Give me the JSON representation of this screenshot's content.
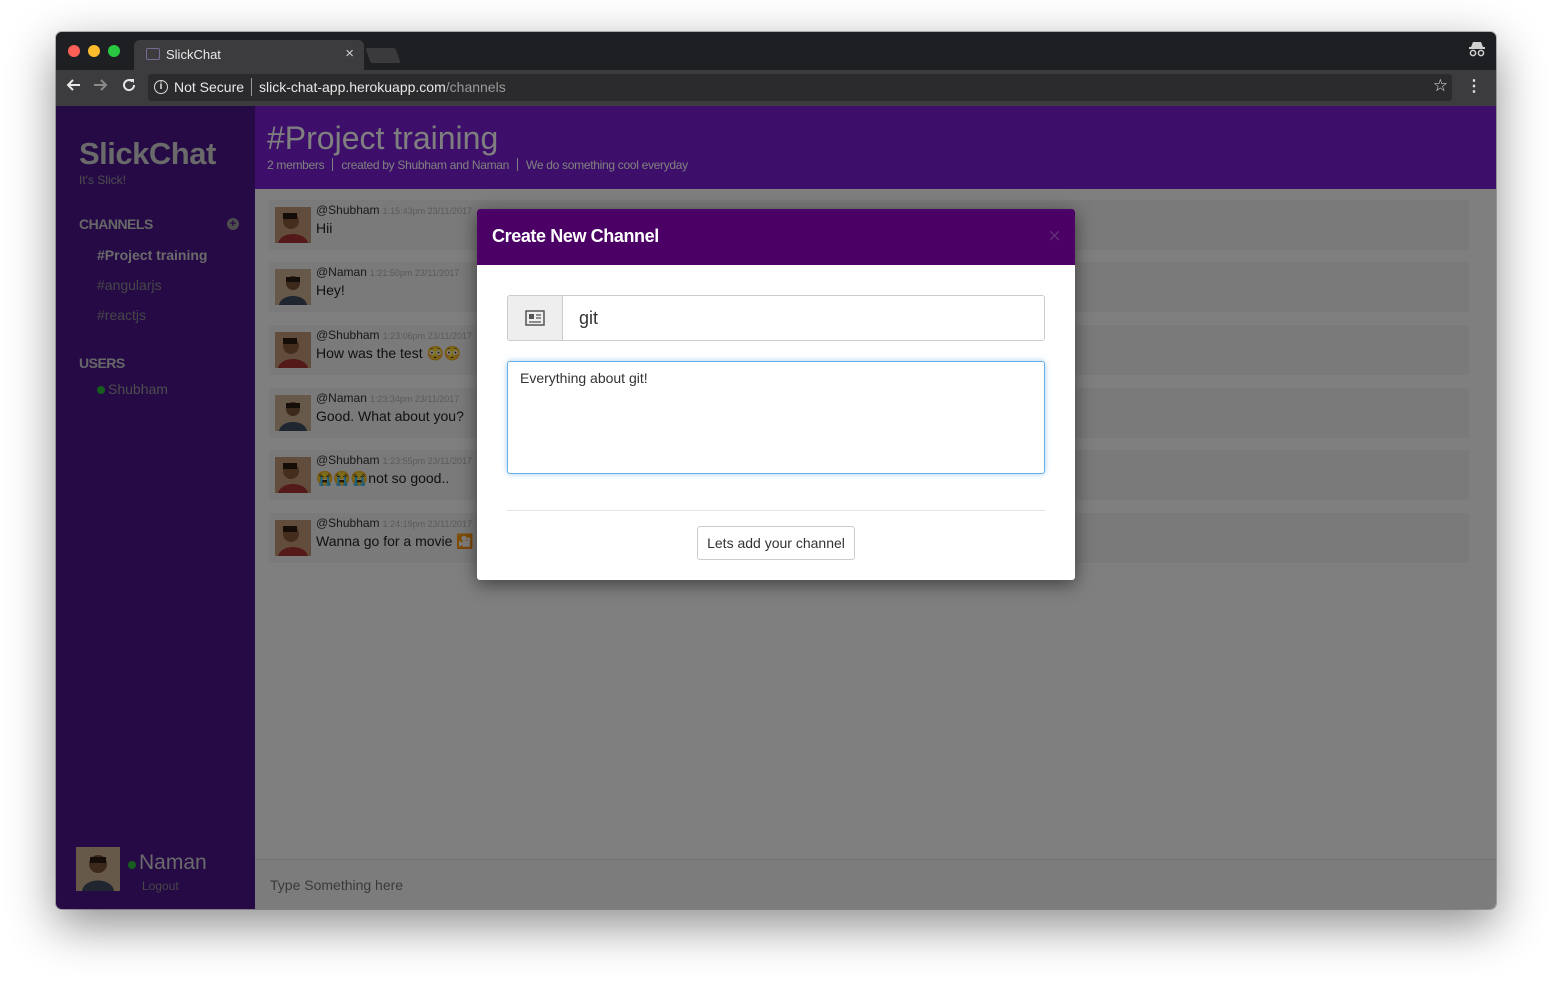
{
  "browser": {
    "tab_title": "SlickChat",
    "tab_close": "×",
    "security_label": "Not Secure",
    "url_host": "slick-chat-app.herokuapp.com",
    "url_path": "/channels"
  },
  "sidebar": {
    "brand": "SlickChat",
    "tagline": "It's Slick!",
    "channels_heading": "CHANNELS",
    "channels": [
      {
        "label": "#Project training",
        "active": true
      },
      {
        "label": "#angularjs",
        "active": false
      },
      {
        "label": "#reactjs",
        "active": false
      }
    ],
    "users_heading": "USERS",
    "users": [
      {
        "label": "Shubham",
        "status_color": "#2dbd3a"
      }
    ],
    "current_user": {
      "name": "Naman",
      "logout": "Logout",
      "status_color": "#2dbd3a"
    }
  },
  "channel": {
    "title": "#Project training",
    "members": "2 members",
    "created_by": "created by Shubham and Naman",
    "description": "We do something cool everyday"
  },
  "messages": [
    {
      "author": "@Shubham",
      "time": "1:15:43pm 23/11/2017",
      "text": "Hii"
    },
    {
      "author": "@Naman",
      "time": "1:21:50pm 23/11/2017",
      "text": "Hey!"
    },
    {
      "author": "@Shubham",
      "time": "1:23:06pm 23/11/2017",
      "text": "How was the test 😳😳"
    },
    {
      "author": "@Naman",
      "time": "1:23:34pm 23/11/2017",
      "text": "Good. What about you?"
    },
    {
      "author": "@Shubham",
      "time": "1:23:55pm 23/11/2017",
      "text": "😭😭😭not so good.."
    },
    {
      "author": "@Shubham",
      "time": "1:24:19pm 23/11/2017",
      "text": "Wanna go for a movie 🎦"
    }
  ],
  "composer": {
    "placeholder": "Type Something here"
  },
  "modal": {
    "title": "Create New Channel",
    "close": "×",
    "name_value": "git",
    "description_value": "Everything about git!",
    "submit_label": "Lets add your channel"
  }
}
